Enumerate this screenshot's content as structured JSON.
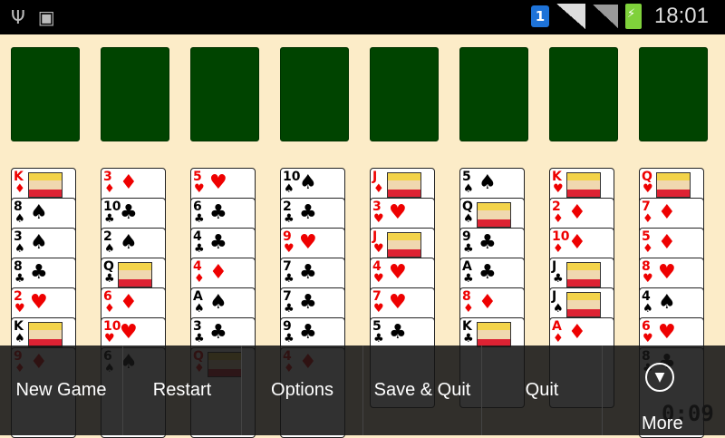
{
  "status": {
    "time": "18:01",
    "notification_badge": "1"
  },
  "foundations": 8,
  "tableau": [
    [
      {
        "r": "K",
        "s": "♦",
        "c": "red",
        "face": true
      },
      {
        "r": "8",
        "s": "♠",
        "c": "black"
      },
      {
        "r": "3",
        "s": "♠",
        "c": "black"
      },
      {
        "r": "8",
        "s": "♣",
        "c": "black"
      },
      {
        "r": "2",
        "s": "♥",
        "c": "red"
      },
      {
        "r": "K",
        "s": "♠",
        "c": "black",
        "face": true
      },
      {
        "r": "9",
        "s": "♦",
        "c": "red"
      }
    ],
    [
      {
        "r": "3",
        "s": "♦",
        "c": "red"
      },
      {
        "r": "10",
        "s": "♣",
        "c": "black"
      },
      {
        "r": "2",
        "s": "♠",
        "c": "black"
      },
      {
        "r": "Q",
        "s": "♣",
        "c": "black",
        "face": true
      },
      {
        "r": "6",
        "s": "♦",
        "c": "red"
      },
      {
        "r": "10",
        "s": "♥",
        "c": "red"
      },
      {
        "r": "6",
        "s": "♠",
        "c": "black"
      }
    ],
    [
      {
        "r": "5",
        "s": "♥",
        "c": "red"
      },
      {
        "r": "6",
        "s": "♣",
        "c": "black"
      },
      {
        "r": "4",
        "s": "♣",
        "c": "black"
      },
      {
        "r": "4",
        "s": "♦",
        "c": "red"
      },
      {
        "r": "A",
        "s": "♠",
        "c": "black"
      },
      {
        "r": "3",
        "s": "♣",
        "c": "black"
      },
      {
        "r": "Q",
        "s": "♦",
        "c": "red",
        "face": true
      }
    ],
    [
      {
        "r": "10",
        "s": "♠",
        "c": "black"
      },
      {
        "r": "2",
        "s": "♣",
        "c": "black"
      },
      {
        "r": "9",
        "s": "♥",
        "c": "red"
      },
      {
        "r": "7",
        "s": "♣",
        "c": "black"
      },
      {
        "r": "7",
        "s": "♣",
        "c": "black"
      },
      {
        "r": "9",
        "s": "♣",
        "c": "black"
      },
      {
        "r": "4",
        "s": "♦",
        "c": "red"
      }
    ],
    [
      {
        "r": "J",
        "s": "♦",
        "c": "red",
        "face": true
      },
      {
        "r": "3",
        "s": "♥",
        "c": "red"
      },
      {
        "r": "J",
        "s": "♥",
        "c": "red",
        "face": true
      },
      {
        "r": "4",
        "s": "♥",
        "c": "red"
      },
      {
        "r": "7",
        "s": "♥",
        "c": "red"
      },
      {
        "r": "5",
        "s": "♣",
        "c": "black"
      }
    ],
    [
      {
        "r": "5",
        "s": "♠",
        "c": "black"
      },
      {
        "r": "Q",
        "s": "♠",
        "c": "black",
        "face": true
      },
      {
        "r": "9",
        "s": "♣",
        "c": "black"
      },
      {
        "r": "A",
        "s": "♣",
        "c": "black"
      },
      {
        "r": "8",
        "s": "♦",
        "c": "red"
      },
      {
        "r": "K",
        "s": "♣",
        "c": "black",
        "face": true
      }
    ],
    [
      {
        "r": "K",
        "s": "♥",
        "c": "red",
        "face": true
      },
      {
        "r": "2",
        "s": "♦",
        "c": "red"
      },
      {
        "r": "10",
        "s": "♦",
        "c": "red"
      },
      {
        "r": "J",
        "s": "♣",
        "c": "black",
        "face": true
      },
      {
        "r": "J",
        "s": "♠",
        "c": "black",
        "face": true
      },
      {
        "r": "A",
        "s": "♦",
        "c": "red"
      }
    ],
    [
      {
        "r": "Q",
        "s": "♥",
        "c": "red",
        "face": true
      },
      {
        "r": "7",
        "s": "♦",
        "c": "red"
      },
      {
        "r": "5",
        "s": "♦",
        "c": "red"
      },
      {
        "r": "8",
        "s": "♥",
        "c": "red"
      },
      {
        "r": "4",
        "s": "♠",
        "c": "black"
      },
      {
        "r": "6",
        "s": "♥",
        "c": "red"
      },
      {
        "r": "8",
        "s": "♣",
        "c": "black"
      }
    ]
  ],
  "menu": {
    "new_game": "New Game",
    "restart": "Restart",
    "options": "Options",
    "save_quit": "Save & Quit",
    "quit": "Quit",
    "more": "More"
  },
  "timer": "0:09"
}
